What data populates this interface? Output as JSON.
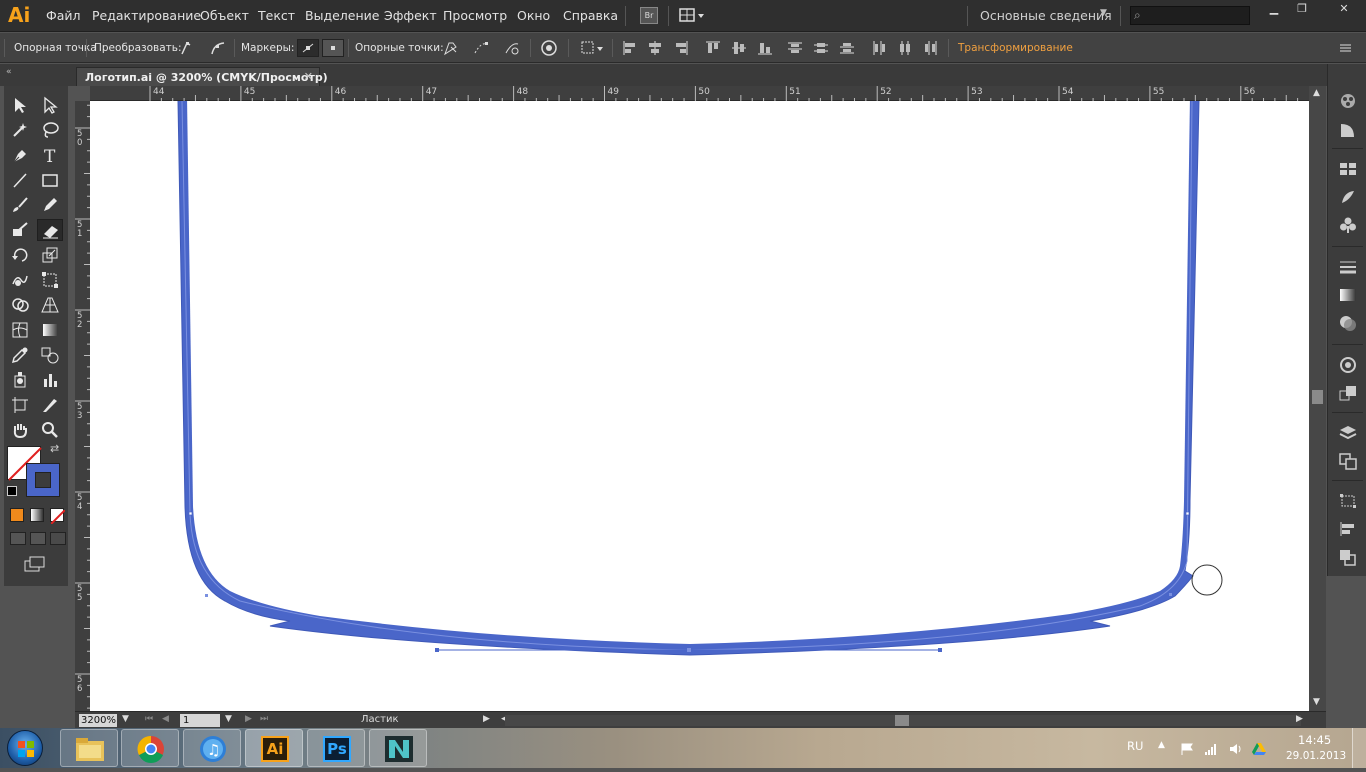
{
  "app": {
    "logo": "Ai",
    "menu": [
      "Файл",
      "Редактирование",
      "Объект",
      "Текст",
      "Выделение",
      "Эффект",
      "Просмотр",
      "Окно",
      "Справка"
    ],
    "bridge_label": "Br",
    "workspace": "Основные сведения",
    "search_placeholder": ""
  },
  "control_bar": {
    "anchor_label": "Опорная точка",
    "convert_label": "Преобразовать:",
    "handles_label": "Маркеры:",
    "anchors_label": "Опорные точки:",
    "transform_link": "Трансформирование"
  },
  "document": {
    "tab_title": "Логотип.ai @ 3200% (CMYK/Просмотр)"
  },
  "rulers": {
    "horizontal": [
      "44",
      "45",
      "46",
      "47",
      "48",
      "49",
      "50",
      "51",
      "52",
      "53",
      "54",
      "55",
      "56"
    ],
    "vertical": [
      {
        "d1": "5",
        "d2": "0"
      },
      {
        "d1": "5",
        "d2": "1"
      },
      {
        "d1": "5",
        "d2": "2"
      },
      {
        "d1": "5",
        "d2": "3"
      },
      {
        "d1": "5",
        "d2": "4"
      },
      {
        "d1": "5",
        "d2": "5"
      },
      {
        "d1": "5",
        "d2": "6"
      }
    ]
  },
  "status_bar": {
    "zoom": "3200%",
    "page": "1",
    "current_tool": "Ластик"
  },
  "taskbar": {
    "apps": [
      "Проводник",
      "Chrome",
      "iTunes",
      "Illustrator",
      "Photoshop",
      "3ds Max"
    ],
    "app_labels": {
      "illustrator": "Ai",
      "photoshop": "Ps"
    },
    "language": "RU",
    "time": "14:45",
    "date": "29.01.2013"
  },
  "colors": {
    "stroke_blue": "#4a66c9",
    "ai_orange": "#f7a21b",
    "ps_blue": "#31a8ff"
  }
}
